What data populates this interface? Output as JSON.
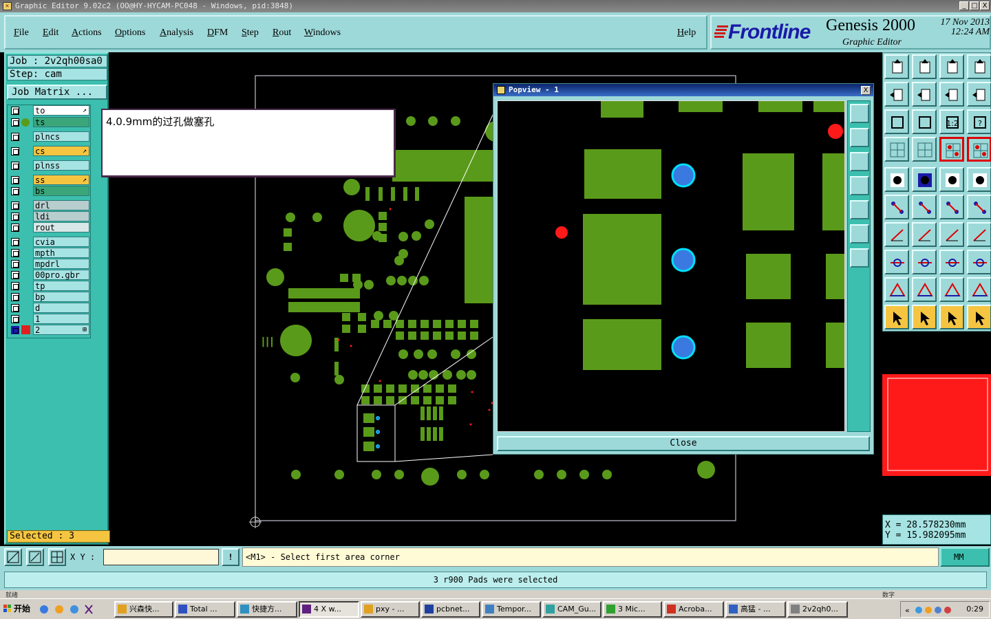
{
  "window": {
    "title": "Graphic Editor 9.02c2 (OO@HY-HYCAM-PC048 - Windows, pid:3848)",
    "buttons": [
      "_",
      "□",
      "X"
    ]
  },
  "menu": {
    "items": [
      "File",
      "Edit",
      "Actions",
      "Options",
      "Analysis",
      "DFM",
      "Step",
      "Rout",
      "Windows"
    ],
    "help": "Help"
  },
  "logo": {
    "brand": "Frontline",
    "product": "Genesis 2000",
    "subtitle": "Graphic Editor",
    "date": "17 Nov 2013",
    "time": "12:24 AM"
  },
  "job": {
    "job_label": "Job : 2v2qh00sa0",
    "step_label": "Step: cam",
    "matrix_button": "Job Matrix ..."
  },
  "layers": [
    {
      "name": "to",
      "color": "#ffffff",
      "mark": "↗"
    },
    {
      "name": "ts",
      "color": "#3aa67a",
      "mark": ""
    },
    {
      "name": "plncs",
      "color": "#a6e3e3",
      "mark": ""
    },
    {
      "name": "cs",
      "color": "#f5c542",
      "mark": "↗"
    },
    {
      "name": "plnss",
      "color": "#a6e3e3",
      "mark": ""
    },
    {
      "name": "ss",
      "color": "#f5c542",
      "mark": "↗"
    },
    {
      "name": "bs",
      "color": "#3aa67a",
      "mark": ""
    },
    {
      "name": "drl",
      "color": "#b8cece",
      "mark": ""
    },
    {
      "name": "ldi",
      "color": "#b8cece",
      "mark": ""
    },
    {
      "name": "rout",
      "color": "#d8e8e8",
      "mark": ""
    },
    {
      "name": "cvia",
      "color": "#a6e3e3",
      "mark": ""
    },
    {
      "name": "mpth",
      "color": "#a6e3e3",
      "mark": ""
    },
    {
      "name": "mpdrl",
      "color": "#a6e3e3",
      "mark": ""
    },
    {
      "name": "00pro.gbr",
      "color": "#a6e3e3",
      "mark": ""
    },
    {
      "name": "tp",
      "color": "#a6e3e3",
      "mark": ""
    },
    {
      "name": "bp",
      "color": "#a6e3e3",
      "mark": ""
    },
    {
      "name": "d",
      "color": "#a6e3e3",
      "mark": ""
    },
    {
      "name": "1",
      "color": "#a6e3e3",
      "mark": ""
    },
    {
      "name": "2",
      "color": "#a6e3e3",
      "mark": "⊞"
    }
  ],
  "selected": "Selected : 3",
  "note": {
    "text": "4.0.9mm的过孔做塞孔"
  },
  "popview": {
    "title": "Popview - 1",
    "close_x": "X",
    "close_button": "Close"
  },
  "coords": {
    "x": "X = 28.578230mm",
    "y": "Y = 15.982095mm"
  },
  "cmd": {
    "xy_label": "X Y :",
    "xy_value": "",
    "info_button": "!",
    "prompt": "<M1> - Select first area corner",
    "units": "MM"
  },
  "status_message": "3 r900 Pads were selected",
  "strip": {
    "left": "就绪",
    "right": "数字"
  },
  "taskbar": {
    "start": "开始",
    "tasks": [
      "兴森快...",
      "Total ...",
      "快捷方...",
      "4 X w...",
      "pxy - ...",
      "pcbnet...",
      "Tempor...",
      "CAM_Gu...",
      "3 Mic...",
      "Acroba...",
      "高猛 - ...",
      "2v2qh0..."
    ],
    "clock": "0:29"
  },
  "colors": {
    "pad": "#5a9a1a",
    "via_fill": "#3a7ae0",
    "via_ring": "#00e0ff",
    "marker": "#ff1a1a",
    "panel": "#9ed9d9",
    "layer_panel": "#3cbfae"
  }
}
